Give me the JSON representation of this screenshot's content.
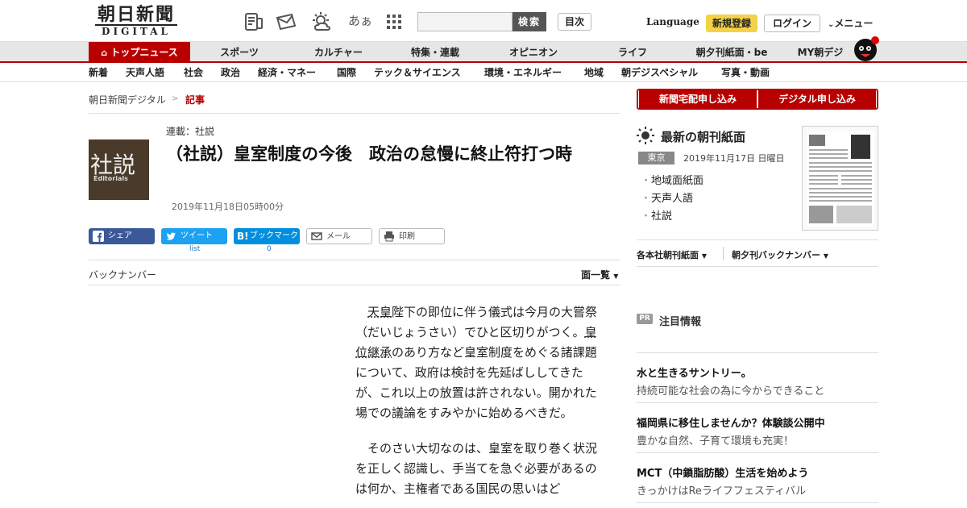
{
  "header": {
    "logo_jp": "朝日新聞",
    "logo_en": "DIGITAL",
    "search_button": "検索",
    "toc_button": "目次",
    "language": "Language",
    "register": "新規登録",
    "login": "ログイン",
    "menu": "メニュー",
    "text_size_icon_label": "あぁ",
    "icons": [
      "newspaper-icon",
      "mail-icon",
      "weather-icon",
      "text-size-icon",
      "grid-icon"
    ]
  },
  "nav_primary": [
    "トップニュース",
    "スポーツ",
    "カルチャー",
    "特集・連載",
    "オピニオン",
    "ライフ",
    "朝夕刊紙面・be",
    "MY朝デジ"
  ],
  "nav_secondary": [
    "新着",
    "天声人語",
    "社会",
    "政治",
    "経済・マネー",
    "国際",
    "テック＆サイエンス",
    "環境・エネルギー",
    "地域",
    "朝デジスペシャル",
    "写真・動画"
  ],
  "breadcrumb": {
    "home": "朝日新聞デジタル",
    "sep": ">",
    "current": "記事"
  },
  "article": {
    "thumb_jp": "社説",
    "thumb_en": "Editorials",
    "series": "連載：社説",
    "title": "（社説）皇室制度の今後　政治の怠慢に終止符打つ時",
    "date": "2019年11月18日05時00分",
    "share": {
      "facebook": "シェア",
      "twitter": "ツイート",
      "twitter_sub": "list",
      "hatena": "ブックマーク",
      "hatena_sub": "0",
      "mail": "メール",
      "print": "印刷"
    },
    "back_number": "バックナンバー",
    "page_list": "面一覧",
    "p1_a": "天皇",
    "p1_b": "陛下の即位に伴う儀式は今月の大嘗祭（だいじょうさい）でひと区切りがつく。",
    "p1_c": "皇位継承",
    "p1_d": "のあり方など皇室制度をめぐる諸課題について、政府は検討を先延ばししてきたが、これ以上の放置は許されない。開かれた場での議論をすみやかに始めるべきだ。",
    "p2": "そのさい大切なのは、皇室を取り巻く状況を正しく認識し、手当てを急ぐ必要があるのは何か、主権者である国民の思いはど"
  },
  "sidebar": {
    "subscribe_home": "新聞宅配申し込み",
    "subscribe_digital": "デジタル申し込み",
    "latest_title": "最新の朝刊紙面",
    "region": "東京",
    "paper_date": "2019年11月17日 日曜日",
    "links": [
      "地域面紙面",
      "天声人語",
      "社説"
    ],
    "subnav_1": "各本社朝刊紙面",
    "subnav_2": "朝夕刊バックナンバー",
    "pr": "PR",
    "notice": "注目情報",
    "ads": [
      {
        "title": "水と生きるサントリー。",
        "desc": "持続可能な社会の為に今からできること"
      },
      {
        "title": "福岡県に移住しませんか？体験談公開中",
        "desc": "豊かな自然、子育て環境も充実！"
      },
      {
        "title": "MCT（中鎖脂肪酸）生活を始めよう",
        "desc": "きっかけはReライフフェスティバル"
      }
    ]
  },
  "colors": {
    "accent": "#b80000",
    "register": "#f5d245",
    "facebook": "#3b5998",
    "twitter": "#1da1f2",
    "hatena": "#008fde"
  }
}
